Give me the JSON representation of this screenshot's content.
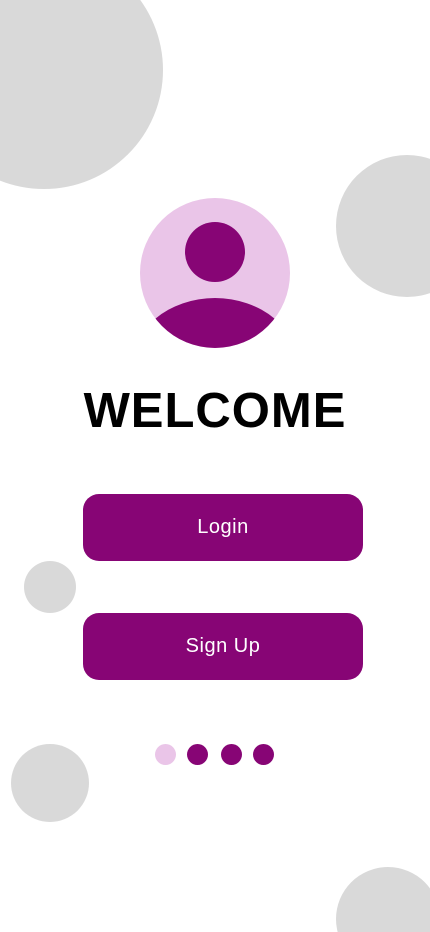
{
  "title": "WELCOME",
  "buttons": {
    "login_label": "Login",
    "signup_label": "Sign Up"
  },
  "pagination": {
    "total": 4,
    "active_index": 0
  },
  "avatar": {
    "icon": "user-avatar-icon"
  },
  "colors": {
    "primary": "#870575",
    "primary_light": "#eac5e8",
    "decor_gray": "#d9d9d9",
    "background": "#ffffff",
    "title_text": "#000000"
  }
}
